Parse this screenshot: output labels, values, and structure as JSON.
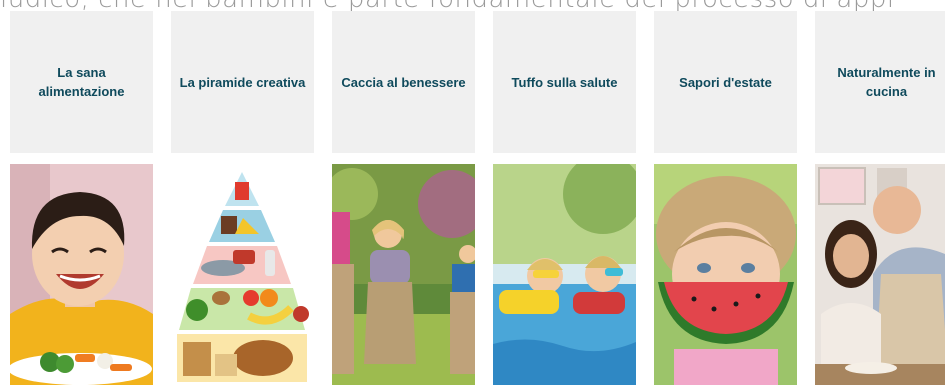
{
  "intro_text": "ludico, che nei bambini è parte fondamentale del processo di appr",
  "cards": [
    {
      "title": "La sana alimentazione",
      "image": "boy-eating-vegetables"
    },
    {
      "title": "La piramide creativa",
      "image": "food-pyramid"
    },
    {
      "title": "Caccia al benessere",
      "image": "sack-race-children"
    },
    {
      "title": "Tuffo sulla salute",
      "image": "children-swimming-pool"
    },
    {
      "title": "Sapori d'estate",
      "image": "girl-eating-watermelon"
    },
    {
      "title": "Naturalmente in cucina",
      "image": "chef-and-girl-kitchen"
    }
  ],
  "colors": {
    "title_text": "#0f4a5c",
    "card_bg": "#f0f0f0",
    "intro_text": "#9a9a9a"
  }
}
